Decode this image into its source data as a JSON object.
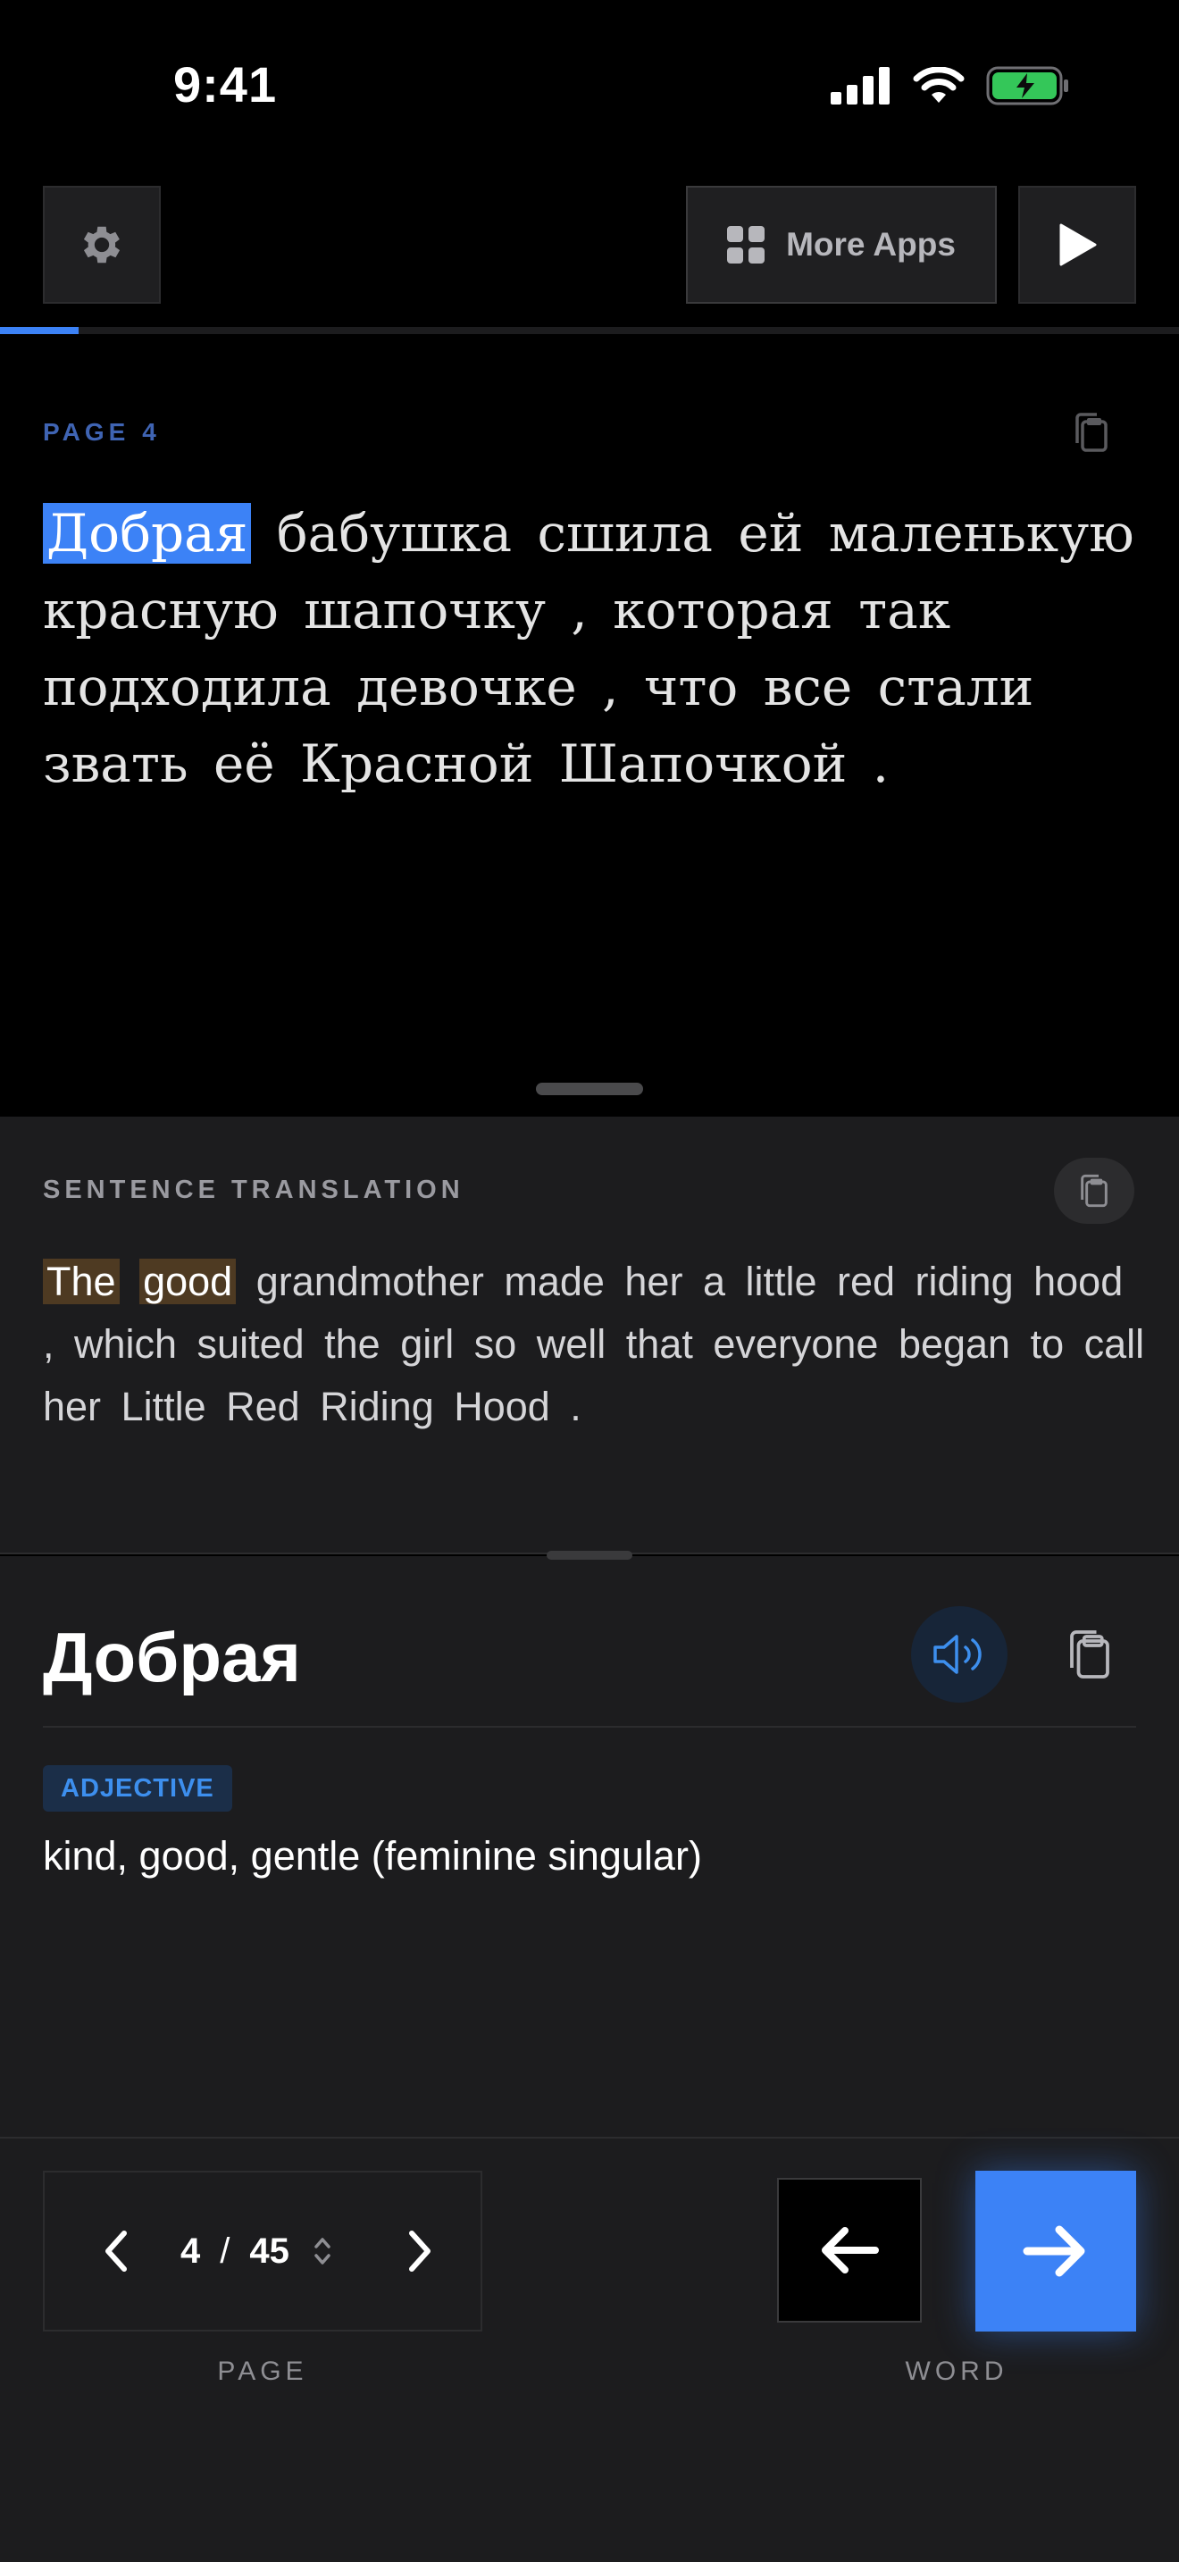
{
  "status_bar": {
    "time": "9:41"
  },
  "toolbar": {
    "more_apps_label": "More Apps"
  },
  "reading_progress": 0.067,
  "reading": {
    "page_label": "PAGE",
    "page_number": "4",
    "highlighted_word": "Добрая",
    "rest_text": "бабушка сшила ей маленькую красную шапочку , которая так подходила девочке , что все стали звать её Красной Шапочкой ."
  },
  "translation": {
    "label": "SENTENCE TRANSLATION",
    "highlight_1": "The",
    "highlight_2": "good",
    "rest_text": "grandmother made her a little red riding hood , which suited the girl so well that everyone began to call her Little Red Riding Hood ."
  },
  "word": {
    "title": "Добрая",
    "part_of_speech": "ADJECTIVE",
    "definition": "kind, good, gentle (feminine singular)"
  },
  "pager": {
    "current": "4",
    "separator": "/",
    "total": "45",
    "caption": "PAGE"
  },
  "word_nav": {
    "caption": "WORD"
  },
  "colors": {
    "accent": "#3c82f6",
    "highlight_warm": "#4e3a22",
    "badge_text": "#3d8fee"
  }
}
